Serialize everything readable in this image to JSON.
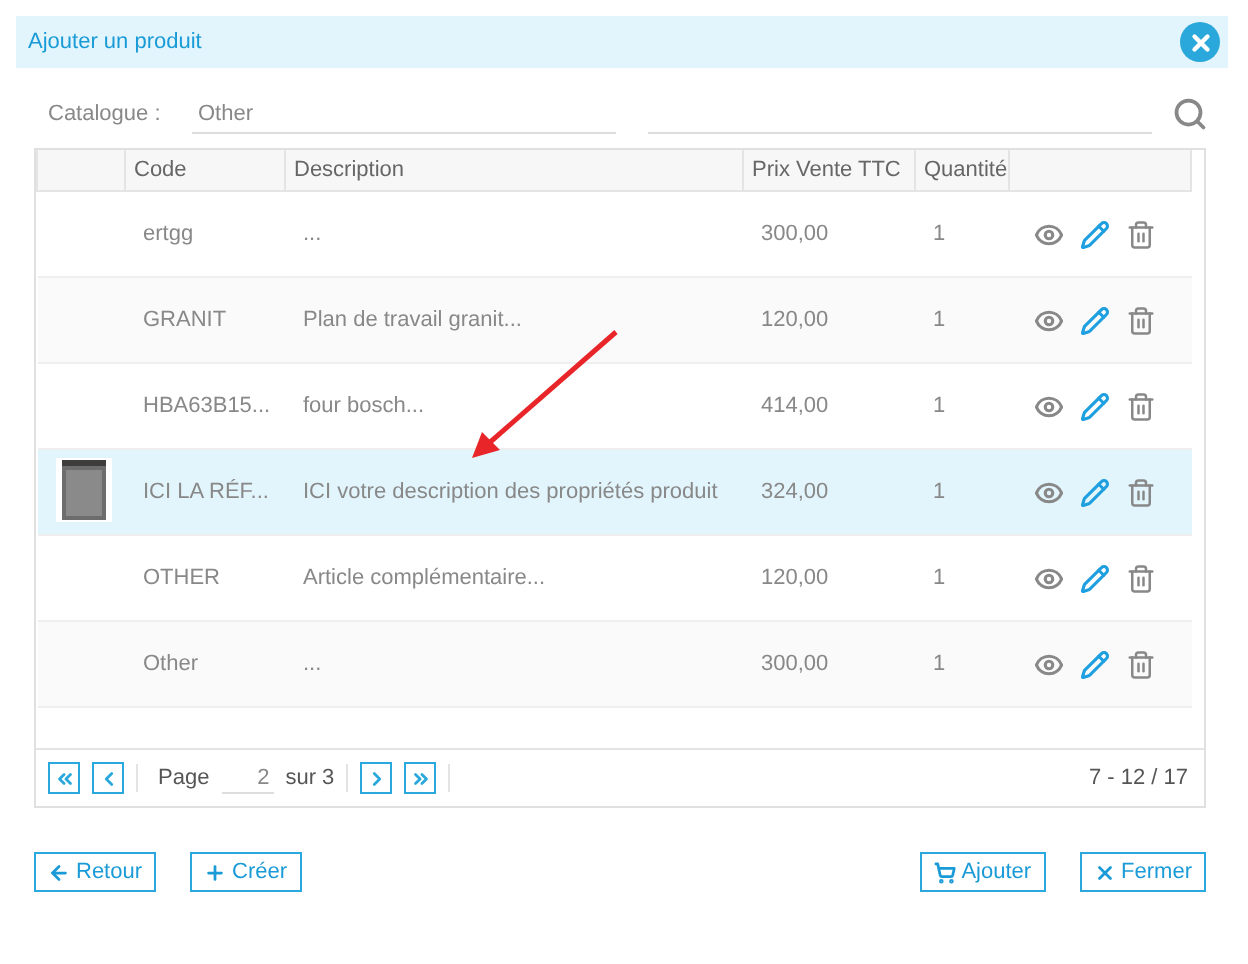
{
  "dialog": {
    "title": "Ajouter un produit"
  },
  "filter": {
    "label": "Catalogue :",
    "catalogue": "Other"
  },
  "table": {
    "columns": [
      "Code",
      "Description",
      "Prix Vente TTC",
      "Quantité"
    ],
    "rows": [
      {
        "code": "ertgg",
        "description": "...",
        "price": "300,00",
        "quantity": "1",
        "has_image": false,
        "selected": false
      },
      {
        "code": "GRANIT",
        "description": "Plan de travail granit...",
        "price": "120,00",
        "quantity": "1",
        "has_image": false,
        "selected": false
      },
      {
        "code": "HBA63B15...",
        "description": "four bosch...",
        "price": "414,00",
        "quantity": "1",
        "has_image": false,
        "selected": false
      },
      {
        "code": "ICI LA RÉF...",
        "description": "ICI votre description des propriétés produit",
        "price": "324,00",
        "quantity": "1",
        "has_image": true,
        "selected": true
      },
      {
        "code": "OTHER",
        "description": "Article complémentaire...",
        "price": "120,00",
        "quantity": "1",
        "has_image": false,
        "selected": false
      },
      {
        "code": "Other",
        "description": "...",
        "price": "300,00",
        "quantity": "1",
        "has_image": false,
        "selected": false
      }
    ]
  },
  "pager": {
    "page_label": "Page",
    "page": "2",
    "of": "sur 3",
    "range": "7 - 12 / 17"
  },
  "buttons_left": [
    "Retour",
    "Créer"
  ],
  "buttons_right": [
    "Ajouter",
    "Fermer"
  ]
}
